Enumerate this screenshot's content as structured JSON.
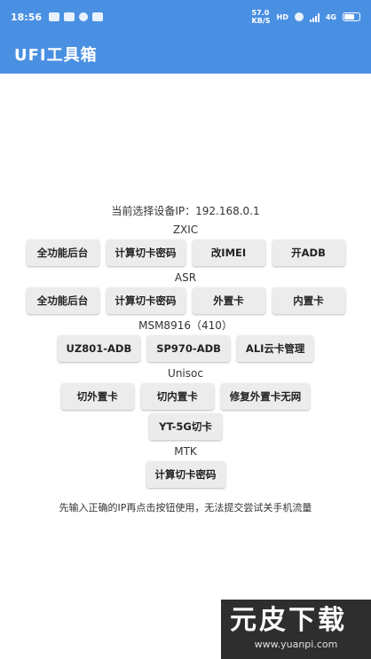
{
  "status_bar": {
    "time": "18:56",
    "speed": "57.0",
    "speed_unit": "KB/S",
    "sim_badge": "HD",
    "network": "4G"
  },
  "app_bar": {
    "title": "UFI工具箱"
  },
  "device": {
    "ip_label": "当前选择设备IP：192.168.0.1"
  },
  "sections": {
    "zxic": {
      "title": "ZXIC",
      "buttons": {
        "full_backend": "全功能后台",
        "calc_card_pwd": "计算切卡密码",
        "change_imei": "改IMEI",
        "open_adb": "开ADB"
      }
    },
    "asr": {
      "title": "ASR",
      "buttons": {
        "full_backend": "全功能后台",
        "calc_card_pwd": "计算切卡密码",
        "external_card": "外置卡",
        "internal_card": "内置卡"
      }
    },
    "msm8916": {
      "title": "MSM8916（410）",
      "buttons": {
        "uz801_adb": "UZ801-ADB",
        "sp970_adb": "SP970-ADB",
        "ali_cloud_card": "ALI云卡管理"
      }
    },
    "unisoc": {
      "title": "Unisoc",
      "buttons": {
        "switch_external": "切外置卡",
        "switch_internal": "切内置卡",
        "fix_external_no_network": "修复外置卡无网",
        "yt_5g_switch": "YT-5G切卡"
      }
    },
    "mtk": {
      "title": "MTK",
      "buttons": {
        "calc_card_pwd": "计算切卡密码"
      }
    }
  },
  "hint": "先输入正确的IP再点击按钮使用，无法提交尝试关手机流量",
  "watermark": {
    "brand": "元皮下载",
    "url": "www.yuanpi.com"
  },
  "colors": {
    "primary": "#4a90e2",
    "button_bg": "#ececec",
    "background": "#ffffff"
  },
  "icons": [
    "app-notification-icon",
    "warning-icon",
    "settings-icon",
    "close-icon",
    "wifi-icon",
    "signal-icon",
    "battery-icon"
  ]
}
